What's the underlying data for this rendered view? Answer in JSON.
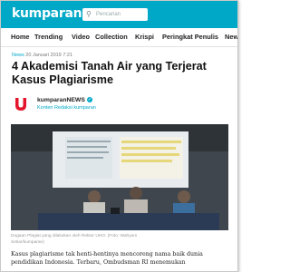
{
  "header": {
    "logo": "kumparan",
    "search_placeholder": "Pencarian",
    "brand_color": "#00a8c8"
  },
  "nav": {
    "items": [
      "Home",
      "Trending",
      "Video",
      "Collection",
      "Krispi",
      "Peringkat Penulis",
      "News"
    ]
  },
  "article": {
    "category": "News",
    "date": "20 Januari 2019 7:21",
    "title_line1": "4 Akademisi Tanah Air yang Terjerat",
    "title_line2": "Kasus Plagiarisme",
    "author": {
      "name": "kumparanNEWS",
      "role": "Konten Redaksi kumparan",
      "logo_letter": "U"
    },
    "photo_caption_line1": "Dugaan Plagiat yang dilakukan oleh Rektor UHO. (Foto: Wahyum",
    "photo_caption_line2": "Setiar/kumparan)",
    "body_line1": "Kasus plagiarisme tak henti-hentinya mencoreng nama baik dunia",
    "body_line2": "pendidikan Indonesia. Terbaru, Ombudsman RI menemukan"
  },
  "icons": {
    "search": "search-icon",
    "verified": "verified-badge-icon"
  }
}
